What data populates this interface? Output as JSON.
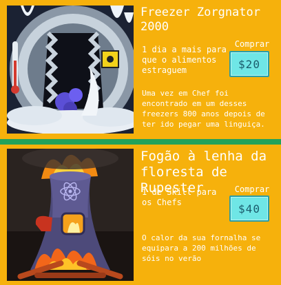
{
  "colors": {
    "background": "#22a25a",
    "card": "#f6b10c",
    "text": "#ffffff",
    "price_button_bg": "#6fe6e6",
    "price_button_text": "#1b5b6c"
  },
  "items": [
    {
      "title": "Freezer Zorgnator 2000",
      "benefit": "1 dia a mais para que o alimentos estraguem",
      "buy_label": "Comprar",
      "price": "$20",
      "description": "Uma vez em Chef foi encontrado em um desses freezers 800 anos depois de ter ido pegar uma linguiça.",
      "icon": "freezer-illustration-icon"
    },
    {
      "title": "Fogão à lenha da floresta de Rupester",
      "benefit": "1 de Skill para os Chefs",
      "buy_label": "Comprar",
      "price": "$40",
      "description": "O calor da sua fornalha se equipara a 200 milhões de sóis no verão",
      "icon": "wood-stove-illustration-icon"
    }
  ]
}
